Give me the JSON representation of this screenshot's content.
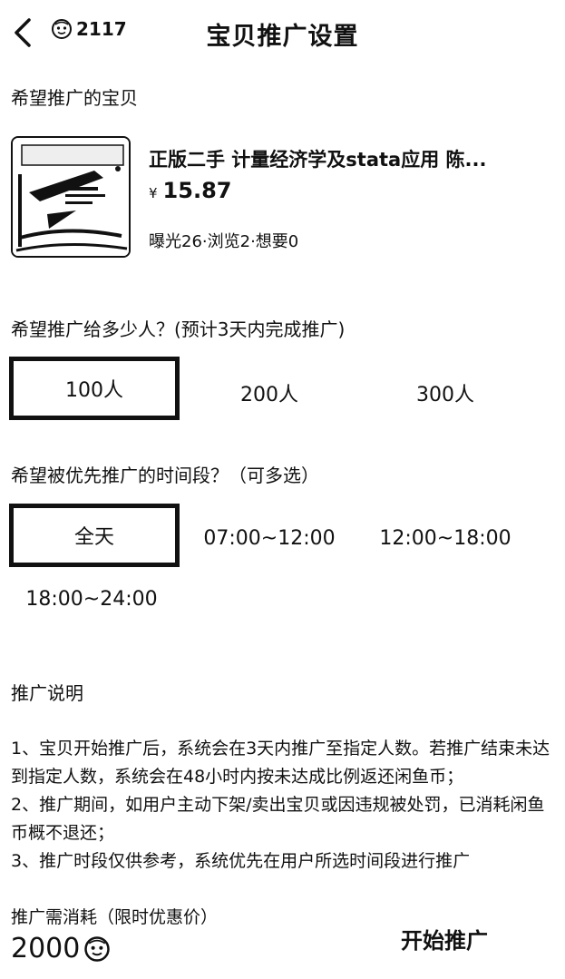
{
  "header": {
    "title": "宝贝推广设置",
    "coin_count": "2117"
  },
  "item_section": {
    "label": "希望推广的宝贝",
    "name": "正版二手 计量经济学及stata应用 陈...",
    "currency": "¥",
    "price": "15.87",
    "stats": "曝光26·浏览2·想要0"
  },
  "audience_section": {
    "label": "希望推广给多少人？(预计3天内完成推广)",
    "options": [
      "100人",
      "200人",
      "300人"
    ],
    "selected": 0
  },
  "time_section": {
    "label": "希望被优先推广的时间段？（可多选）",
    "options": [
      "全天",
      "07:00~12:00",
      "12:00~18:00",
      "18:00~24:00"
    ],
    "selected": [
      0
    ]
  },
  "notes": {
    "title": "推广说明",
    "items": [
      "1、宝贝开始推广后，系统会在3天内推广至指定人数。若推广结束未达到指定人数，系统会在48小时内按未达成比例返还闲鱼币；",
      "2、推广期间，如用户主动下架/卖出宝贝或因违规被处罚，已消耗闲鱼币概不退还；",
      "3、推广时段仅供参考，系统优先在用户所选时间段进行推广"
    ]
  },
  "footer": {
    "cost_label": "推广需消耗（限时优惠价）",
    "cost_value": "2000",
    "start_label": "开始推广"
  },
  "icons": {
    "back": "chevron-left-icon",
    "coin": "fish-coin-icon"
  }
}
